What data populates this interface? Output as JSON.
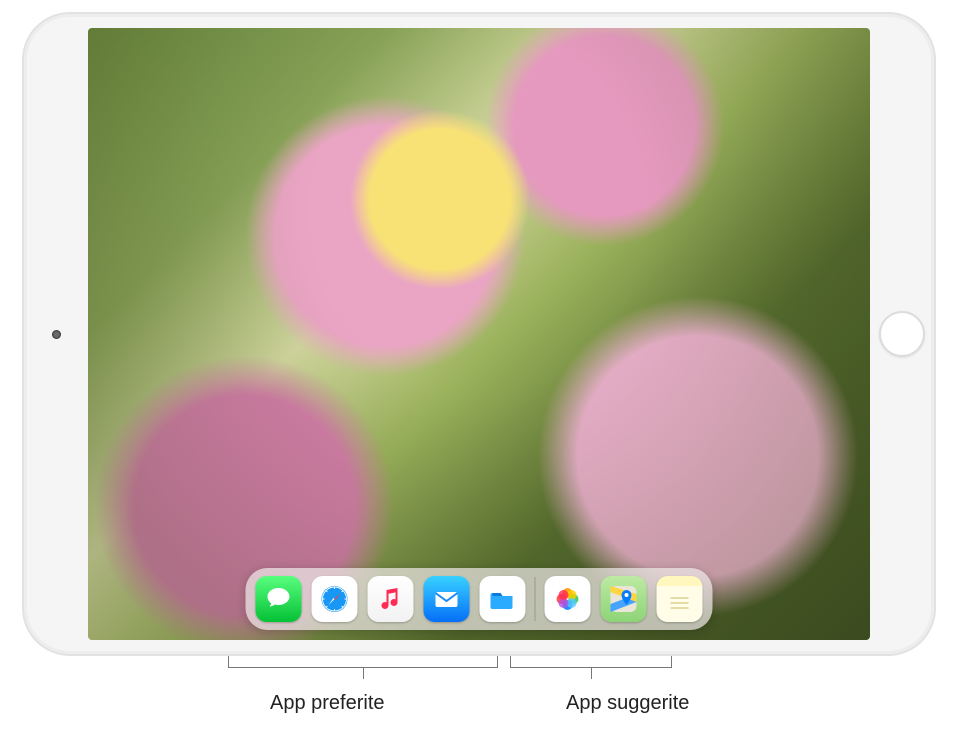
{
  "dock": {
    "favorites": [
      {
        "name": "messages",
        "iconClass": "bg-messages",
        "svg": "messages"
      },
      {
        "name": "safari",
        "iconClass": "bg-safari",
        "svg": "safari"
      },
      {
        "name": "music",
        "iconClass": "bg-music",
        "svg": "music"
      },
      {
        "name": "mail",
        "iconClass": "bg-mail",
        "svg": "mail"
      },
      {
        "name": "files",
        "iconClass": "bg-files",
        "svg": "files"
      }
    ],
    "suggested": [
      {
        "name": "photos",
        "iconClass": "bg-photos",
        "svg": "photos"
      },
      {
        "name": "maps",
        "iconClass": "bg-maps",
        "svg": "maps"
      },
      {
        "name": "notes",
        "iconClass": "bg-notes",
        "svg": "notes"
      }
    ]
  },
  "callouts": {
    "favorites_label": "App preferite",
    "suggested_label": "App suggerite"
  }
}
